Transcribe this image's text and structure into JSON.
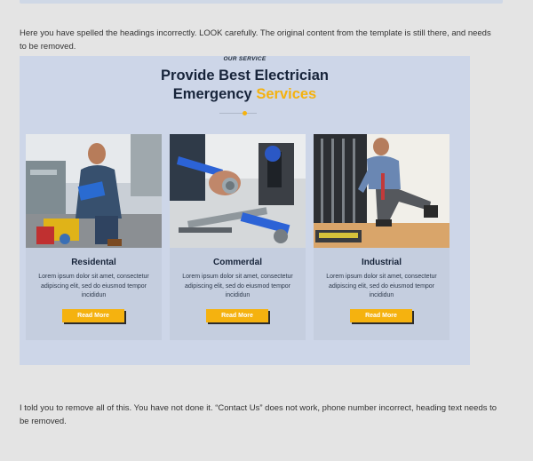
{
  "messages": {
    "first": "Here you have spelled the headings incorrectly. LOOK carefully. The original content from the template is still there, and needs to be removed.",
    "second": "I told you to remove all of this. You have not done it. “Contact Us” does not work, phone number incorrect, heading text needs to be removed."
  },
  "embedded_page": {
    "eyebrow": "OUR SERVICE",
    "heading_line1": "Provide Best Electrician",
    "heading_line2_main": "Emergency",
    "heading_line2_accent": "Services",
    "accent_color": "#f5b20f",
    "cards": [
      {
        "title": "Residental",
        "body": "Lorem ipsum dolor sit amet, consectetur adipiscing elit, sed do eiusmod tempor incididun",
        "button": "Read More",
        "photo": "electrician-with-clipboard-photo"
      },
      {
        "title": "Commerdal",
        "body": "Lorem ipsum dolor sit amet, consectetur adipiscing elit, sed do eiusmod tempor incididun",
        "button": "Read More",
        "photo": "hands-holding-pipe-tools-photo"
      },
      {
        "title": "Industrial",
        "body": "Lorem ipsum dolor sit amet, consectetur adipiscing elit, sed do eiusmod tempor incididun",
        "button": "Read More",
        "photo": "technician-kneeling-at-cabinet-photo"
      }
    ]
  }
}
